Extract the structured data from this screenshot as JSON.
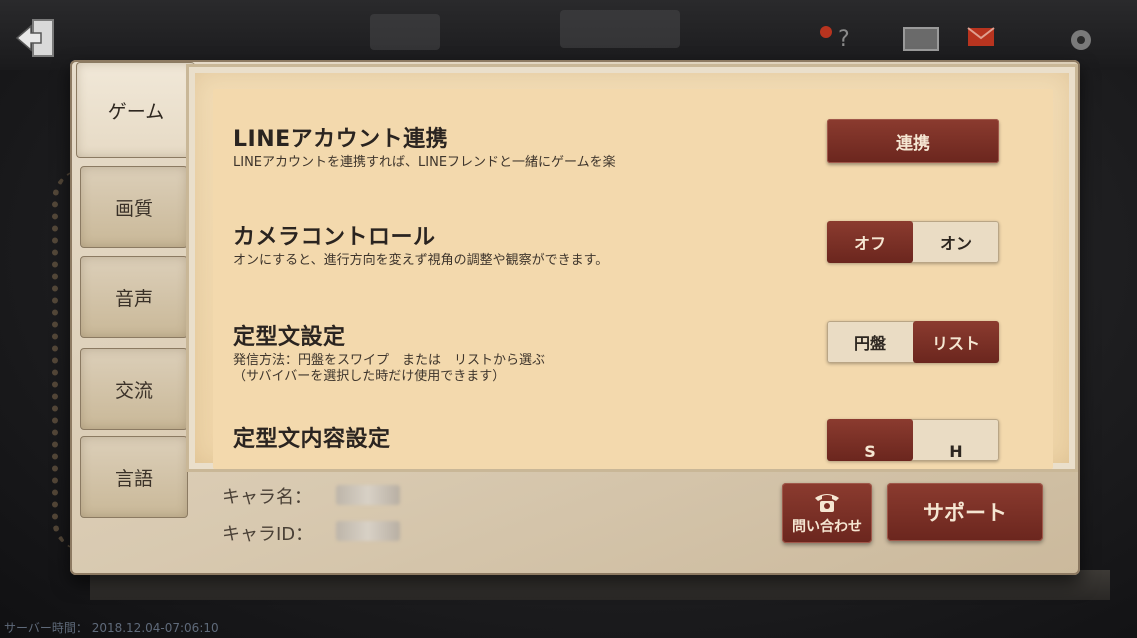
{
  "tabs": [
    {
      "label": "ゲーム",
      "active": true
    },
    {
      "label": "画質",
      "active": false
    },
    {
      "label": "音声",
      "active": false
    },
    {
      "label": "交流",
      "active": false
    },
    {
      "label": "言語",
      "active": false
    }
  ],
  "settings": {
    "line": {
      "title": "LINEアカウント連携",
      "desc": "LINEアカウントを連携すれば、LINEフレンドと一緒にゲームを楽",
      "button_label": "連携"
    },
    "camera": {
      "title": "カメラコントロール",
      "desc": "オンにすると、進行方向を変えず視角の調整や観察ができます。",
      "options": [
        "オフ",
        "オン"
      ],
      "selected": "オフ"
    },
    "phrase": {
      "title": "定型文設定",
      "desc": "発信方法：円盤をスワイプ　または　リストから選ぶ\n（サバイバーを選択した時だけ使用できます）",
      "options": [
        "円盤",
        "リスト"
      ],
      "selected": "リスト"
    },
    "phrase_content": {
      "title": "定型文内容設定",
      "options": [
        "S",
        "H"
      ],
      "selected": "S"
    }
  },
  "character": {
    "name_label": "キャラ名：",
    "id_label": "キャラID："
  },
  "buttons": {
    "contact_label": "問い合わせ",
    "support_label": "サポート"
  },
  "server_time": "サーバー時間： 2018.12.04-07:06:10",
  "colors": {
    "accent_red": "#7a2d24",
    "parchment": "#f2d9ad"
  }
}
